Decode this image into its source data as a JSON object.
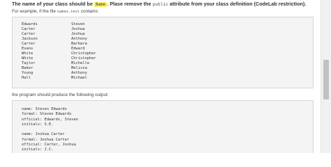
{
  "header": {
    "title_before": "The name of your class should be ",
    "class_name": "Name",
    "title_after": ". Plase remove the ",
    "keyword": "public",
    "title_end": " attribute from your class definition (CodeLab restriction)."
  },
  "intro": {
    "text_before": "For example, if the file ",
    "filename": "names.text",
    "text_after": " contains:"
  },
  "names_file": [
    {
      "last": "Edwards",
      "first": "Steven"
    },
    {
      "last": "Carter",
      "first": "Joshua"
    },
    {
      "last": "Carter",
      "first": "Joshua"
    },
    {
      "last": "Jackson",
      "first": "Anthony"
    },
    {
      "last": "Carter",
      "first": "Barbara"
    },
    {
      "last": "Evans",
      "first": "Edward"
    },
    {
      "last": "White",
      "first": "Christopher"
    },
    {
      "last": "White",
      "first": "Christopher"
    },
    {
      "last": "Taylor",
      "first": "Michelle"
    },
    {
      "last": "Baker",
      "first": "Melissa"
    },
    {
      "last": "Young",
      "first": "Anthony"
    },
    {
      "last": "Hall",
      "first": "Michael"
    }
  ],
  "output_intro": "the program should produce the following output:",
  "output_lines": [
    "name: Steven Edwards",
    "formal: Steven Edwards",
    "official: Edwards, Steven",
    "initials: S.E.",
    "",
    "name: Joshua Carter",
    "formal: Joshua Carter",
    "official: Carter, Joshua",
    "initials: J.C."
  ]
}
